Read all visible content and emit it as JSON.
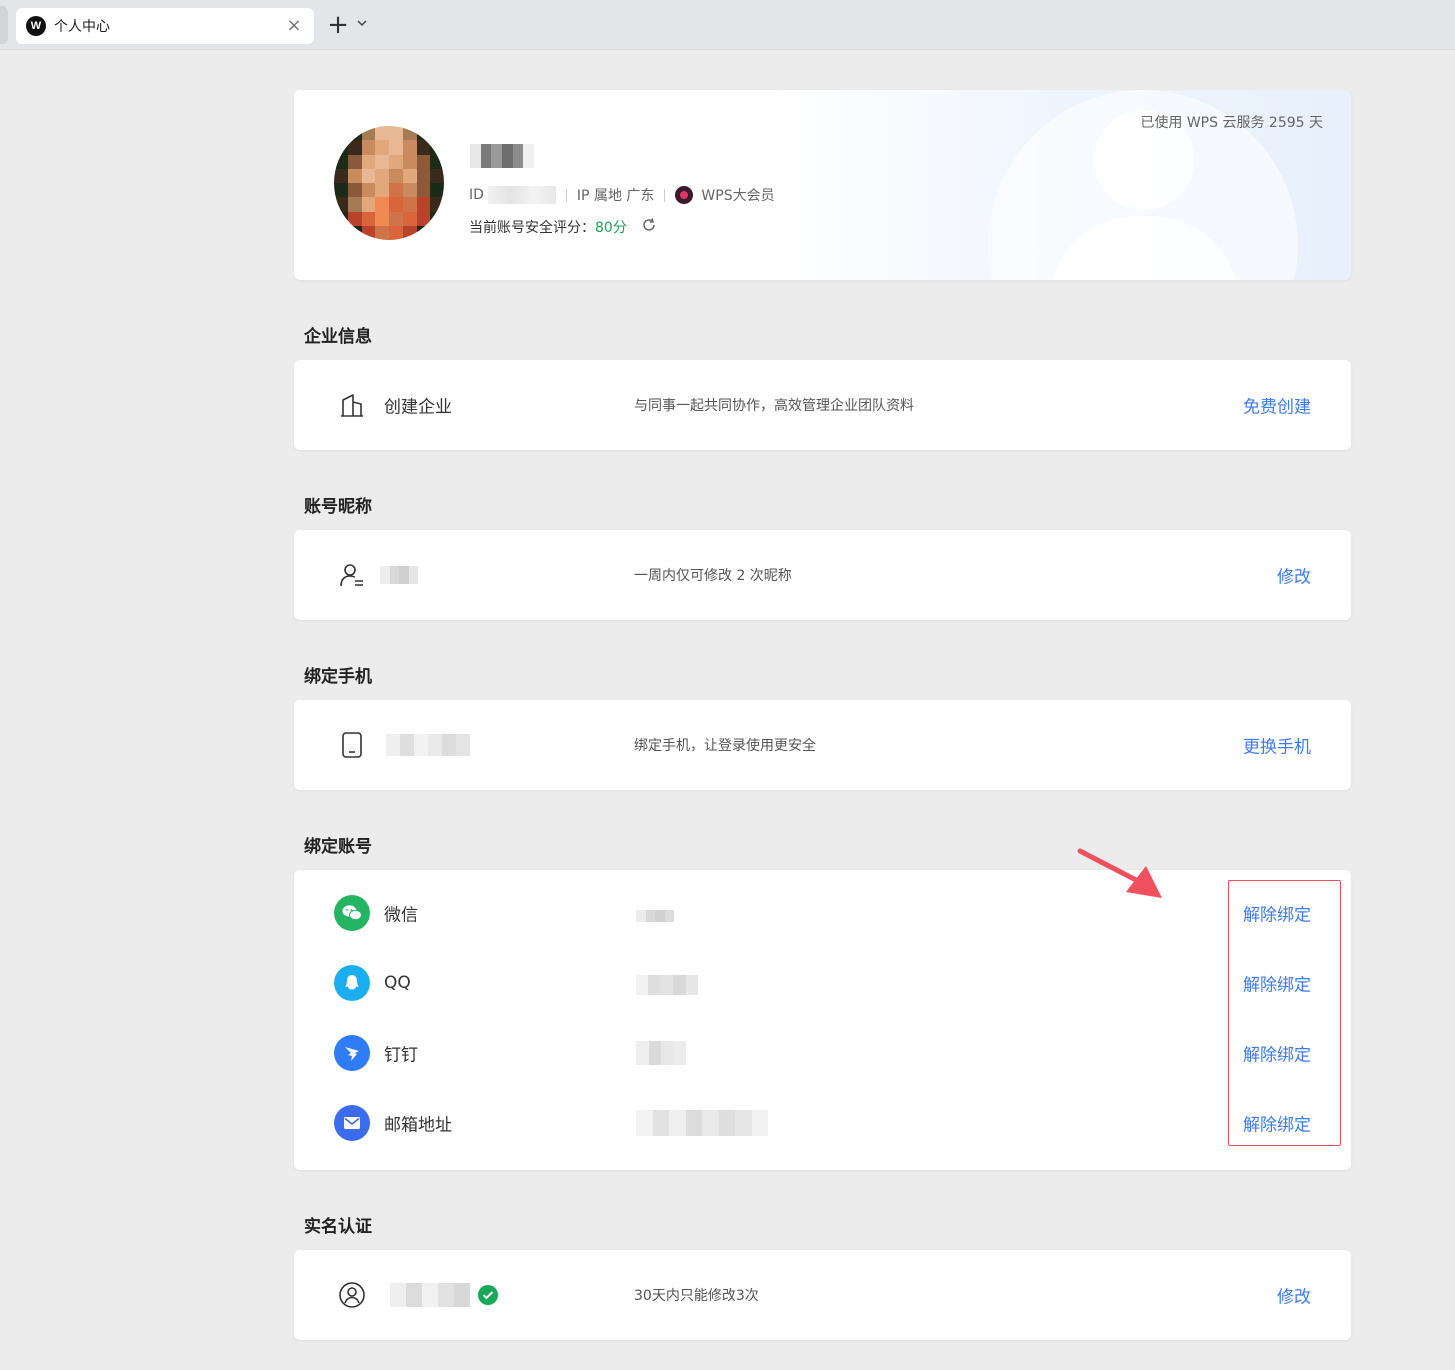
{
  "tab": {
    "title": "个人中心",
    "logo_letter": "W",
    "close_icon": "×",
    "add_icon": "+",
    "dropdown_icon": "⌄"
  },
  "profile": {
    "id_label": "ID",
    "ip_location": "IP 属地 广东",
    "membership": "WPS大会员",
    "security_label": "当前账号安全评分：",
    "security_score": "80分",
    "usage_days": "已使用 WPS 云服务 2595 天",
    "score_color": "#1aa35c"
  },
  "sections": {
    "enterprise": {
      "title": "企业信息",
      "label": "创建企业",
      "desc": "与同事一起共同协作，高效管理企业团队资料",
      "action": "免费创建"
    },
    "nickname": {
      "title": "账号昵称",
      "desc": "一周内仅可修改 2 次昵称",
      "action": "修改"
    },
    "phone": {
      "title": "绑定手机",
      "desc": "绑定手机，让登录使用更安全",
      "action": "更换手机"
    },
    "accounts": {
      "title": "绑定账号",
      "items": [
        {
          "label": "微信",
          "icon": "wechat-icon",
          "color": "#23b464",
          "action": "解除绑定"
        },
        {
          "label": "QQ",
          "icon": "qq-icon",
          "color": "#1aaef0",
          "action": "解除绑定"
        },
        {
          "label": "钉钉",
          "icon": "dingtalk-icon",
          "color": "#2f7cf6",
          "action": "解除绑定"
        },
        {
          "label": "邮箱地址",
          "icon": "mail-icon",
          "color": "#3b6cf0",
          "action": "解除绑定"
        }
      ]
    },
    "realname": {
      "title": "实名认证",
      "desc": "30天内只能修改3次",
      "action": "修改"
    }
  },
  "colors": {
    "accent": "#3d7bf2",
    "annotation": "#f0505e",
    "background": "#ececec"
  }
}
